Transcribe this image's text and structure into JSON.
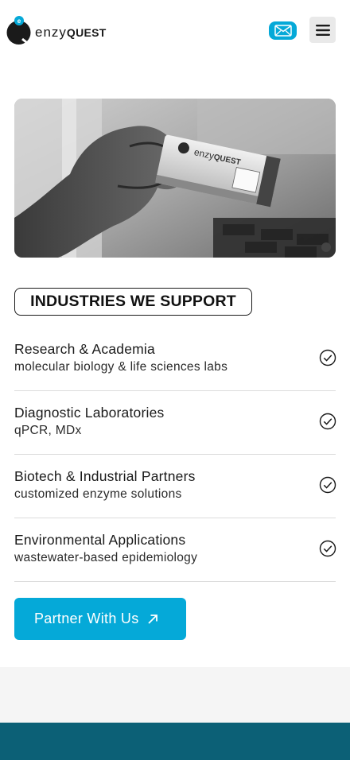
{
  "header": {
    "logo_light": "enzy",
    "logo_bold": "QUEST",
    "mail_icon": "envelope-icon",
    "menu_icon": "hamburger-menu-icon"
  },
  "hero": {
    "image": "gloved-hand-holding-enzyquest-kit-box",
    "box_brand_light": "enzy",
    "box_brand_bold": "QUEST"
  },
  "industries": {
    "title": "INDUSTRIES WE SUPPORT",
    "items": [
      {
        "label": "Research & Academia",
        "sub": "molecular biology & life sciences labs"
      },
      {
        "label": "Diagnostic Laboratories",
        "sub": "qPCR, MDx"
      },
      {
        "label": "Biotech & Industrial Partners",
        "sub": "customized enzyme solutions"
      },
      {
        "label": "Environmental Applications",
        "sub": "wastewater-based epidemiology"
      }
    ],
    "check_icon": "check-circle-icon"
  },
  "cta": {
    "label": "Partner With Us",
    "icon": "arrow-up-right-icon"
  },
  "colors": {
    "accent": "#05a9d8",
    "footer": "#0c6076",
    "band": "#f5f5f5"
  }
}
